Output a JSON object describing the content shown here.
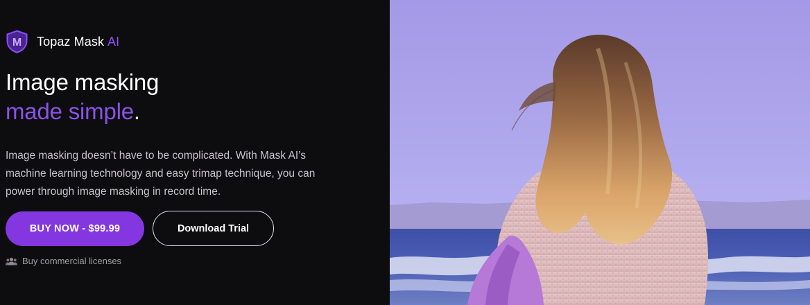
{
  "brand": {
    "name": "Topaz Mask",
    "suffix": "AI",
    "logo_letter": "M",
    "accent_color": "#8a4fff"
  },
  "hero": {
    "headline_line1": "Image masking",
    "headline_accent": "made simple",
    "headline_period": ".",
    "description": "Image masking doesn’t have to be complicated. With Mask AI’s machine learning technology and easy trimap technique, you can power through image masking in record time.",
    "buy_button_label": "BUY NOW - $99.99",
    "trial_button_label": "Download Trial",
    "commercial_link_label": "Buy commercial licenses",
    "commercial_icon": "users-icon"
  },
  "colors": {
    "background": "#0d0c0f",
    "primary_button": "#8436e0",
    "headline_accent": "#8b53e8",
    "sky": "#a79be4"
  }
}
